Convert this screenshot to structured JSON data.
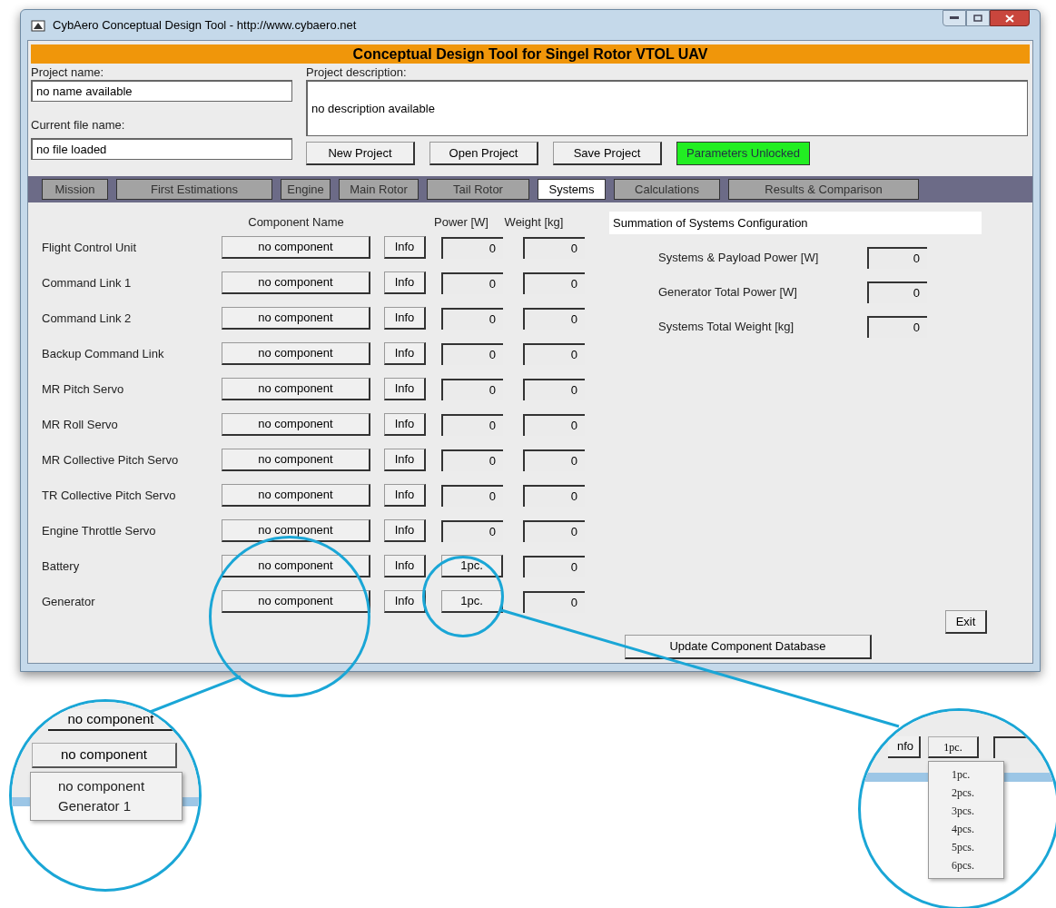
{
  "window": {
    "title": "CybAero Conceptual Design Tool - http://www.cybaero.net"
  },
  "banner": "Conceptual Design Tool for Singel Rotor VTOL UAV",
  "project_name": {
    "label": "Project name:",
    "value": "no name available"
  },
  "file_name": {
    "label": "Current file name:",
    "value": "no file loaded"
  },
  "description": {
    "label": "Project description:",
    "value": "no description available"
  },
  "buttons": [
    "New Project",
    "Open Project",
    "Save Project"
  ],
  "parameters_status": {
    "label": "Parameters Unlocked",
    "locked": false
  },
  "tabs": [
    {
      "label": "Mission",
      "selected": false
    },
    {
      "label": "First Estimations",
      "selected": false
    },
    {
      "label": "Engine",
      "selected": false
    },
    {
      "label": "Main Rotor",
      "selected": false
    },
    {
      "label": "Tail Rotor",
      "selected": false
    },
    {
      "label": "Systems",
      "selected": true
    },
    {
      "label": "Calculations",
      "selected": false
    },
    {
      "label": "Results & Comparison",
      "selected": false
    }
  ],
  "columns": {
    "component": "Component Name",
    "power": "Power [W]",
    "weight": "Weight [kg]"
  },
  "rows": [
    {
      "label": "Flight Control Unit",
      "component": "no component",
      "info": "Info",
      "kind": "field",
      "power": "0",
      "weight": "0"
    },
    {
      "label": "Command Link 1",
      "component": "no component",
      "info": "Info",
      "kind": "field",
      "power": "0",
      "weight": "0"
    },
    {
      "label": "Command Link 2",
      "component": "no component",
      "info": "Info",
      "kind": "field",
      "power": "0",
      "weight": "0"
    },
    {
      "label": "Backup Command Link",
      "component": "no component",
      "info": "Info",
      "kind": "field",
      "power": "0",
      "weight": "0"
    },
    {
      "label": "MR Pitch Servo",
      "component": "no component",
      "info": "Info",
      "kind": "field",
      "power": "0",
      "weight": "0"
    },
    {
      "label": "MR Roll Servo",
      "component": "no component",
      "info": "Info",
      "kind": "field",
      "power": "0",
      "weight": "0"
    },
    {
      "label": "MR Collective Pitch Servo",
      "component": "no component",
      "info": "Info",
      "kind": "field",
      "power": "0",
      "weight": "0"
    },
    {
      "label": "TR Collective Pitch Servo",
      "component": "no component",
      "info": "Info",
      "kind": "field",
      "power": "0",
      "weight": "0"
    },
    {
      "label": "Engine Throttle Servo",
      "component": "no component",
      "info": "Info",
      "kind": "field",
      "power": "0",
      "weight": "0"
    },
    {
      "label": "Battery",
      "component": "no component",
      "info": "Info",
      "kind": "dropdown",
      "power": "1pc.",
      "weight": "0"
    },
    {
      "label": "Generator",
      "component": "no component",
      "info": "Info",
      "kind": "dropdown",
      "power": "1pc.",
      "weight": "0"
    }
  ],
  "summary": {
    "title": "Summation of Systems Configuration",
    "items": [
      {
        "label": "Systems & Payload Power [W]",
        "value": "0"
      },
      {
        "label": "Generator Total Power [W]",
        "value": "0"
      },
      {
        "label": "Systems Total Weight [kg]",
        "value": "0"
      }
    ]
  },
  "update_button": "Update Component Database",
  "exit_button": "Exit",
  "magnifiers": [
    {
      "kind": "component",
      "above": "no component",
      "button": "no component",
      "options": [
        "no component",
        "Generator 1"
      ]
    },
    {
      "kind": "pieces",
      "info": "nfo",
      "button": "1pc.",
      "options": [
        "1pc.",
        "2pcs.",
        "3pcs.",
        "4pcs.",
        "5pcs.",
        "6pcs."
      ]
    }
  ]
}
